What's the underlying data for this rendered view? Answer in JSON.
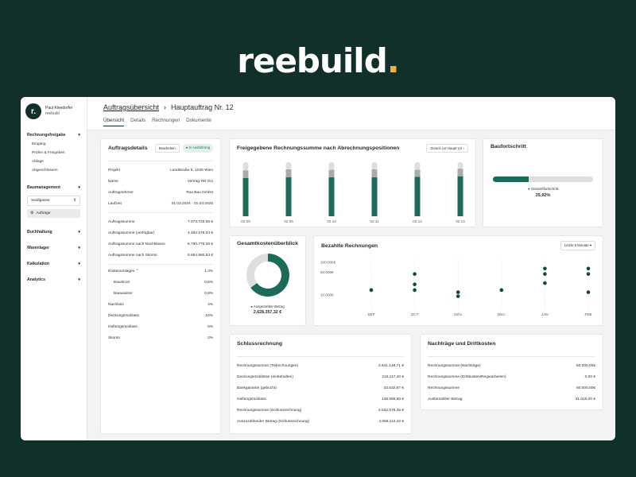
{
  "brand": {
    "name": "reebuild",
    "dot": "."
  },
  "user": {
    "initial": "r.",
    "name": "Paul Kleedorfer",
    "company": "reebuild"
  },
  "sidebar": {
    "rechnungsfreigabe": "Rechnungsfreigabe",
    "sub": [
      "Eingang",
      "Prüfen & Freigeben",
      "Ablage",
      "Abgeschlossen"
    ],
    "baumanagement": "Baumanagement",
    "select_value": "Seidlgasse",
    "auftraege": "Aufträge",
    "buchhaltung": "Buchhaltung",
    "warenlager": "Warenlager",
    "kalkulation": "Kalkulation",
    "analytics": "Analytics"
  },
  "header": {
    "crumb_link": "Auftragsübersicht",
    "separator": "›",
    "current": "Hauptauftrag Nr. 12",
    "tabs": [
      "Übersicht",
      "Details",
      "Rechnungen",
      "Dokumente"
    ]
  },
  "details": {
    "title": "Auftragsdetails",
    "edit": "Bearbeiten",
    "status": "In Ausführung",
    "rows": [
      {
        "k": "Projekt",
        "v": "Landstraße 5, 1030 Wien"
      },
      {
        "k": "Name",
        "v": "Vertrag Teil GU"
      },
      {
        "k": "Auftragnehmer",
        "v": "Rax Bau GmbH"
      },
      {
        "k": "Laufzeit",
        "v": "01.03.2024 - 01.03.2025"
      }
    ],
    "sums": [
      {
        "k": "Auftragssumme",
        "v": "7.073.725,05 €"
      },
      {
        "k": "Auftragssumme (verfügbar)",
        "v": "4.482.576,34 €"
      },
      {
        "k": "Auftragssumme nach Nachlässen",
        "v": "6.790.776,05 €"
      },
      {
        "k": "Auftragssumme nach Skonto",
        "v": "6.654.960,53 €"
      }
    ],
    "kosten_label": "Kostenumlagen",
    "kosten_value": "1,3%",
    "kosten": [
      {
        "k": "Baustrom",
        "v": "0,5%"
      },
      {
        "k": "Bauwasser",
        "v": "0,8%"
      }
    ],
    "rates": [
      {
        "k": "Nachlass",
        "v": "4%"
      },
      {
        "k": "Deckungsrücklass",
        "v": "10%"
      },
      {
        "k": "Haftungsrücklass",
        "v": "5%"
      },
      {
        "k": "Skonto",
        "v": "2%"
      }
    ]
  },
  "freigegeben": {
    "title": "Freigegebene Rechnungssumme nach Abrechnungspositionen",
    "button": "Zurück zur Haupt LG"
  },
  "baufortschritt": {
    "title": "Baufortschritt",
    "legend": "Gesamtfortschritt",
    "value": "35,92%",
    "progress": 0.3592
  },
  "gesamt": {
    "title": "Gesamtkostenüberblick",
    "legend": "Ausgezahlter Betrag",
    "value": "2.628.357,32 €"
  },
  "bezahlt": {
    "title": "Bezahlte Rechnungen",
    "filter": "Letzte 6 Monate"
  },
  "schluss": {
    "title": "Schlussrechnung",
    "rows": [
      {
        "k": "Rechnungssumme (Teilrechnungen)",
        "v": "2.541.148,71 €"
      },
      {
        "k": "Deckungsrücklässe (einbehalten)",
        "v": "215.117,40 €"
      },
      {
        "k": "Bankgarantie (gebucht)",
        "v": "33.632,87 €"
      },
      {
        "k": "Haftungsrücklass",
        "v": "138.568,85 €"
      },
      {
        "k": "Rechnungssumme (Schlussrechnung)",
        "v": "4.532.576,35 €"
      },
      {
        "k": "Auszuzahlender Betrag (Schlussrechnung)",
        "v": "4.069.112,42 €"
      }
    ]
  },
  "nachtraege": {
    "title": "Nachträge und Drittkosten",
    "rows": [
      {
        "k": "Rechnungssumme (Nachträge)",
        "v": "50.000,00€"
      },
      {
        "k": "Rechnungssumme (Drittkosten/Regiearbeiten)",
        "v": "0,00 €"
      },
      {
        "k": "Rechnungssumme",
        "v": "50.000,00€"
      },
      {
        "k": "Ausbezahlter Betrag",
        "v": "41.616,00 €"
      }
    ]
  },
  "colors": {
    "primary": "#1b6b58",
    "gray": "#a8adaa",
    "light": "#dcdfdd",
    "bg": "#12302a",
    "accent": "#f2b33d"
  },
  "chart_data": [
    {
      "type": "bar",
      "title": "Freigegebene Rechnungssumme nach Abrechnungspositionen",
      "categories": [
        "02.05",
        "02.06",
        "02.10",
        "02.11",
        "02.12",
        "02.14"
      ],
      "series": [
        {
          "values": [
            0.71,
            0.72,
            0.72,
            0.72,
            0.73,
            0.74
          ]
        },
        {
          "values": [
            0.14,
            0.15,
            0.14,
            0.15,
            0.13,
            0.14
          ]
        },
        {
          "values": [
            0.15,
            0.13,
            0.14,
            0.13,
            0.14,
            0.12
          ]
        }
      ]
    },
    {
      "type": "pie",
      "title": "Gesamtkostenüberblick",
      "series": [
        {
          "name": "Ausgezahlter Betrag",
          "values": [
            0.65
          ]
        },
        {
          "values": [
            0.35
          ]
        }
      ]
    },
    {
      "type": "scatter",
      "title": "Bezahlte Rechnungen",
      "categories": [
        "SEP",
        "OCT",
        "NOV",
        "DEC",
        "JAN",
        "FEB"
      ],
      "ytick_labels": [
        "100.000€",
        "50.000€",
        "10.000€"
      ],
      "yscale": "log",
      "ylim": [
        5000,
        120000
      ],
      "points": [
        {
          "x": "SEP",
          "y": 14000
        },
        {
          "x": "OCT",
          "y": 14000
        },
        {
          "x": "OCT",
          "y": 21000
        },
        {
          "x": "OCT",
          "y": 44000
        },
        {
          "x": "NOV",
          "y": 9000
        },
        {
          "x": "NOV",
          "y": 12000
        },
        {
          "x": "DEC",
          "y": 14000
        },
        {
          "x": "JAN",
          "y": 23000
        },
        {
          "x": "JAN",
          "y": 44000
        },
        {
          "x": "JAN",
          "y": 65000
        },
        {
          "x": "FEB",
          "y": 12000
        },
        {
          "x": "FEB",
          "y": 44000
        },
        {
          "x": "FEB",
          "y": 65000
        }
      ]
    }
  ]
}
